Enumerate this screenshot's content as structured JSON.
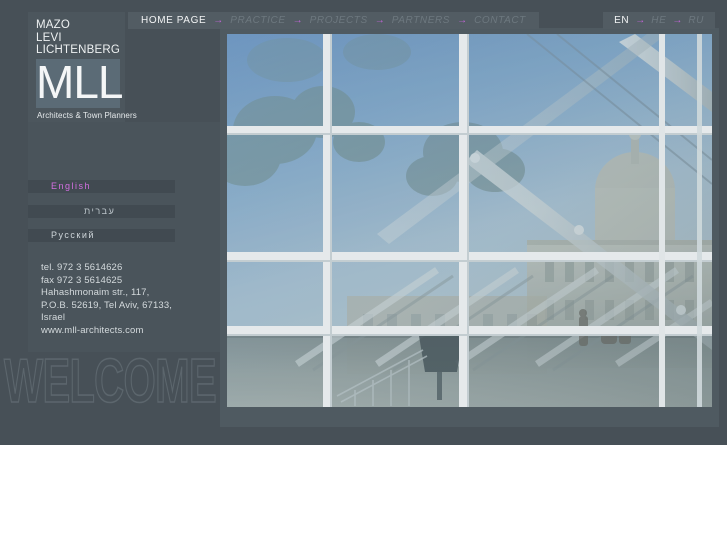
{
  "site": {
    "background_color": "#475057",
    "panel_color": "#4a545b",
    "accent_color": "#c264d8",
    "active_text_color": "#f2f4f5",
    "inactive_text_color": "#6d787f"
  },
  "logo": {
    "line1": "MAZO",
    "line2": "LEVI",
    "line3": "LICHTENBERG",
    "monogram": "MLL",
    "tagline": "Architects & Town Planners"
  },
  "main_nav": {
    "separator": "→",
    "items": [
      {
        "label": "HOME PAGE",
        "state": "active"
      },
      {
        "label": "PRACTICE",
        "state": "inactive"
      },
      {
        "label": "PROJECTS",
        "state": "inactive"
      },
      {
        "label": "PARTNERS",
        "state": "inactive"
      },
      {
        "label": "CONTACT",
        "state": "inactive"
      }
    ]
  },
  "lang_nav": {
    "separator": "→",
    "items": [
      {
        "label": "EN",
        "state": "active"
      },
      {
        "label": "HE",
        "state": "inactive"
      },
      {
        "label": "RU",
        "state": "inactive"
      }
    ]
  },
  "language_buttons": [
    {
      "label": "English",
      "state": "selected",
      "color": "#d26fe0"
    },
    {
      "label": "עברית",
      "state": "normal",
      "color": "#b9c2c8"
    },
    {
      "label": "Русский",
      "state": "normal",
      "color": "#cfd6da"
    }
  ],
  "contact": {
    "tel": "tel. 972 3 5614626",
    "fax": "fax 972 3 5614625",
    "street": "Hahashmonaim str., 117,",
    "city": "P.O.B. 52619, Tel Aviv, 67133,",
    "country": "Israel",
    "website": "www.mll-architects.com"
  },
  "hero": {
    "headline": "WELCOME",
    "image_alt": "Glass atrium facade with reflections of a domed historic building"
  }
}
